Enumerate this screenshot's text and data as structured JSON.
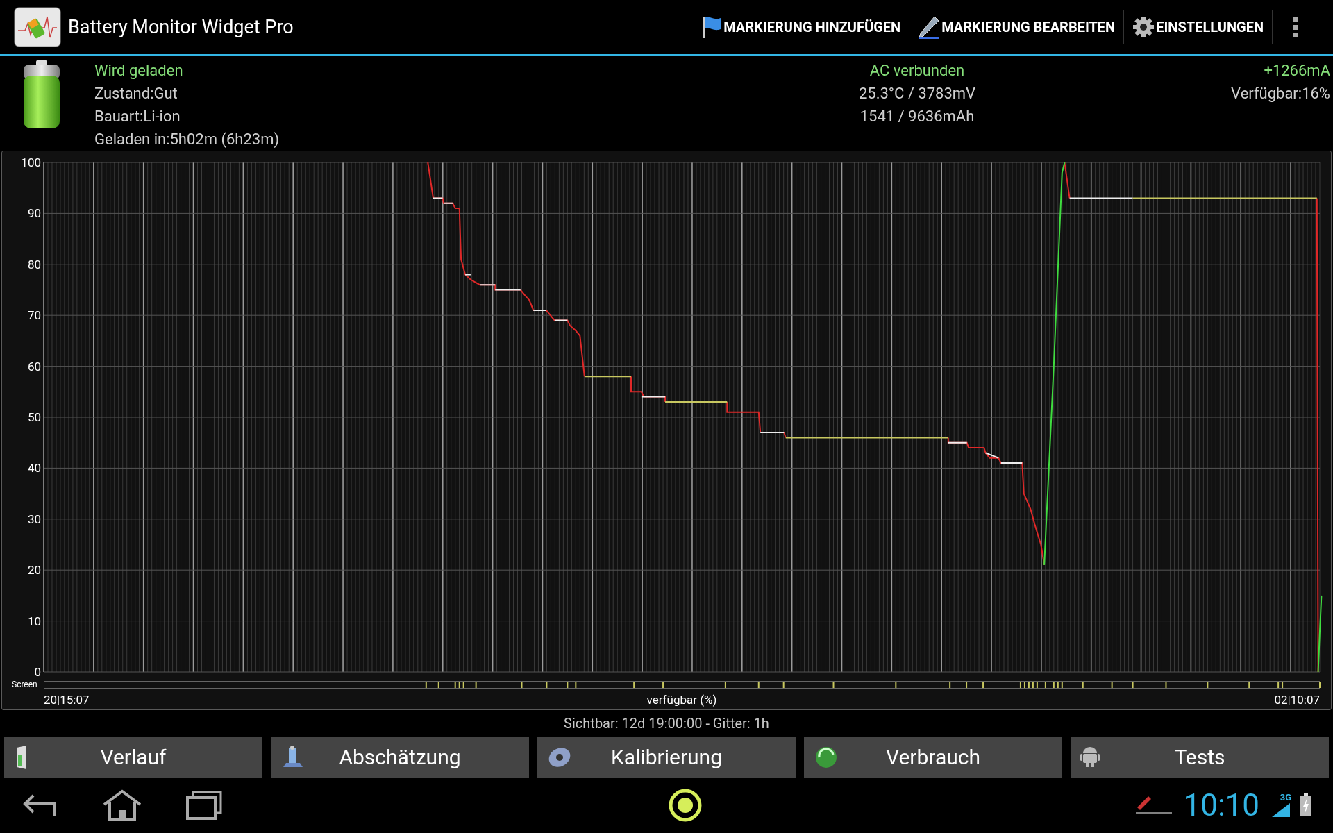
{
  "action_bar": {
    "title": "Battery Monitor Widget Pro",
    "actions": [
      {
        "label": "MARKIERUNG HINZUFÜGEN",
        "kind": "flag"
      },
      {
        "label": "MARKIERUNG BEARBEITEN",
        "kind": "pen"
      },
      {
        "label": "EINSTELLUNGEN",
        "kind": "gear"
      }
    ]
  },
  "status": {
    "left": [
      {
        "text": "Wird geladen",
        "color": "#86e07a"
      },
      {
        "text": "Zustand:Gut",
        "color": "#d0d0d0"
      },
      {
        "text": "Bauart:Li-ion",
        "color": "#d0d0d0"
      },
      {
        "text": "Geladen in:5h02m (6h23m)",
        "color": "#d0d0d0"
      }
    ],
    "center": [
      {
        "text": "AC verbunden",
        "color": "#86e07a"
      },
      {
        "text": "25.3°C / 3783mV",
        "color": "#d0d0d0"
      },
      {
        "text": "1541 / 9636mAh",
        "color": "#d0d0d0"
      }
    ],
    "right": [
      {
        "text": "+1266mA",
        "color": "#86e07a"
      },
      {
        "text": "Verfügbar:16%",
        "color": "#d0d0d0"
      }
    ]
  },
  "chart": {
    "y_labels": [
      "100",
      "90",
      "80",
      "70",
      "60",
      "50",
      "40",
      "30",
      "20",
      "10",
      "0"
    ],
    "screen_label": "Screen",
    "start_label": "20|15:07",
    "axis_title": "verfügbar (%)",
    "end_label": "02|10:07"
  },
  "visible_info": "Sichtbar: 12d 19:00:00 - Gitter: 1h",
  "buttons": [
    {
      "label": "Verlauf",
      "kind": "history"
    },
    {
      "label": "Abschätzung",
      "kind": "estimate"
    },
    {
      "label": "Kalibrierung",
      "kind": "calibrate"
    },
    {
      "label": "Verbrauch",
      "kind": "usage"
    },
    {
      "label": "Tests",
      "kind": "tests"
    }
  ],
  "system_bar": {
    "clock": "10:10",
    "network": "3G"
  }
}
